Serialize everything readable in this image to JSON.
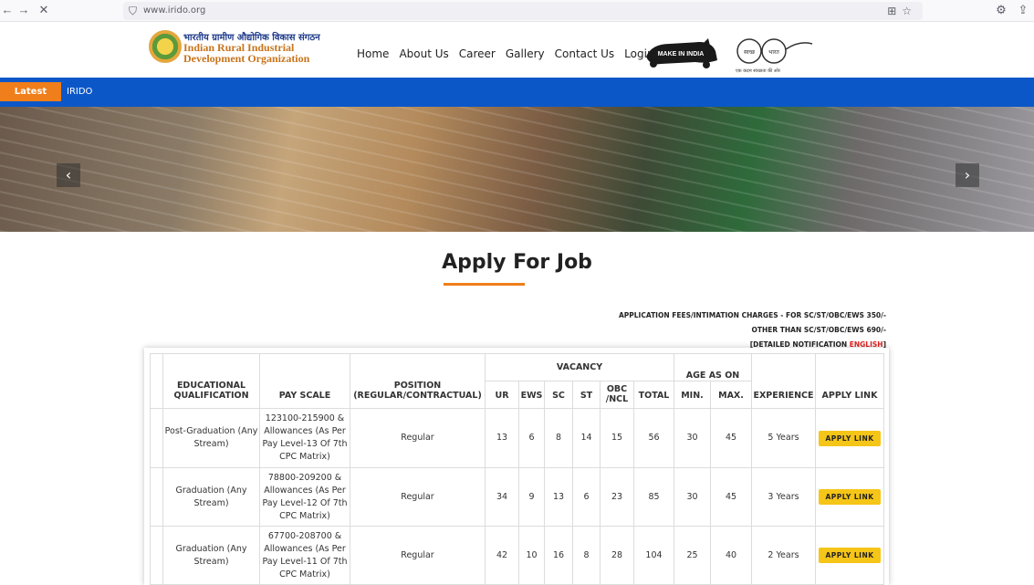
{
  "browser": {
    "url": "www.irido.org"
  },
  "header": {
    "logo_hindi": "भारतीय ग्रामीण औद्योगिक विकास संगठन",
    "logo_line1": "Indian Rural Industrial",
    "logo_line2": "Development Organization",
    "nav": [
      "Home",
      "About Us",
      "Career",
      "Gallery",
      "Contact Us",
      "Login"
    ],
    "make_in_india": "MAKE IN INDIA",
    "swachh_left": "स्वच्छ",
    "swachh_right": "भारत",
    "swachh_tag": "एक कदम स्वच्छता की ओर"
  },
  "news": {
    "label": "Latest News",
    "text": "IRIDO"
  },
  "page_title": "Apply For Job",
  "fees": {
    "line1": "APPLICATION FEES/INTIMATION CHARGES - FOR SC/ST/OBC/EWS 350/-",
    "line2": "OTHER THAN SC/ST/OBC/EWS 690/-",
    "line3_prefix": "[DETAILED NOTIFICATION ",
    "line3_link": "ENGLISH",
    "line3_suffix": "]"
  },
  "table": {
    "headers": {
      "qualification": "EDUCATIONAL QUALIFICATION",
      "pay_scale": "PAY SCALE",
      "position": "POSITION (REGULAR/CONTRACTUAL)",
      "vacancy": "VACANCY",
      "ur": "UR",
      "ews": "EWS",
      "sc": "SC",
      "st": "ST",
      "obc": "OBC /NCL",
      "total": "TOTAL",
      "age": "AGE AS ON",
      "min": "MIN.",
      "max": "MAX.",
      "experience": "EXPERIENCE",
      "apply": "APPLY LINK"
    },
    "rows": [
      {
        "qualification": "Post-Graduation (Any Stream)",
        "pay_scale": "123100-215900 & Allowances (As Per Pay Level-13 Of 7th CPC Matrix)",
        "position": "Regular",
        "ur": "13",
        "ews": "6",
        "sc": "8",
        "st": "14",
        "obc": "15",
        "total": "56",
        "min": "30",
        "max": "45",
        "experience": "5 Years",
        "apply": "APPLY LINK"
      },
      {
        "qualification": "Graduation (Any Stream)",
        "pay_scale": "78800-209200 & Allowances (As Per Pay Level-12 Of 7th CPC Matrix)",
        "position": "Regular",
        "ur": "34",
        "ews": "9",
        "sc": "13",
        "st": "6",
        "obc": "23",
        "total": "85",
        "min": "30",
        "max": "45",
        "experience": "3 Years",
        "apply": "APPLY LINK"
      },
      {
        "qualification": "Graduation (Any Stream)",
        "pay_scale": "67700-208700 & Allowances (As Per Pay Level-11 Of 7th CPC Matrix)",
        "position": "Regular",
        "ur": "42",
        "ews": "10",
        "sc": "16",
        "st": "8",
        "obc": "28",
        "total": "104",
        "min": "25",
        "max": "40",
        "experience": "2 Years",
        "apply": "APPLY LINK"
      }
    ]
  }
}
